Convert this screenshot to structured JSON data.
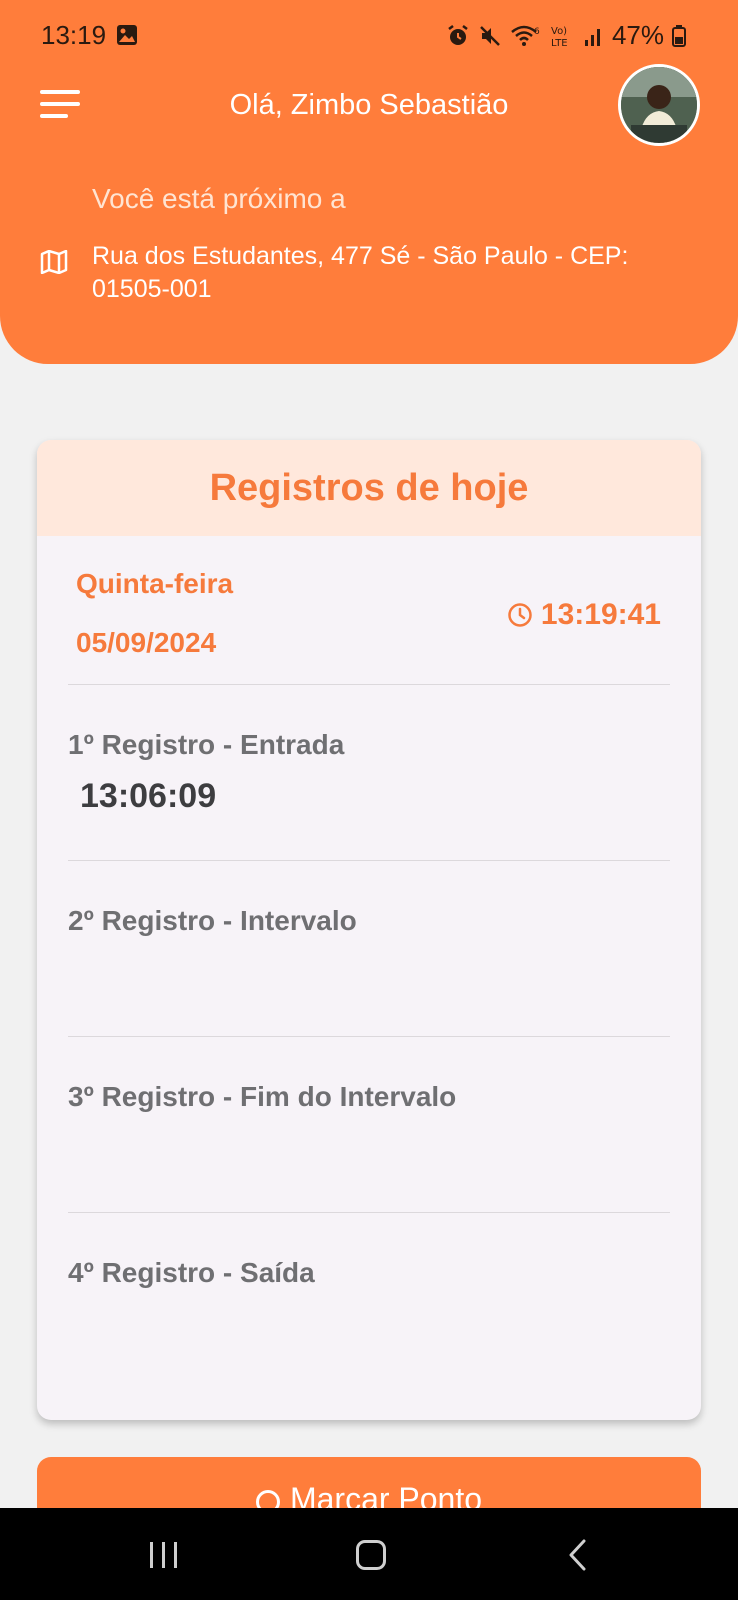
{
  "status_bar": {
    "time": "13:19",
    "battery": "47%"
  },
  "header": {
    "greeting": "Olá, Zimbo Sebastião",
    "near_label": "Você está próximo a",
    "address": "Rua dos Estudantes, 477 Sé - São Paulo - CEP: 01505-001"
  },
  "card": {
    "title": "Registros de hoje",
    "weekday": "Quinta-feira",
    "date": "05/09/2024",
    "clock": "13:19:41",
    "records": [
      {
        "label": "1º Registro - Entrada",
        "time": "13:06:09"
      },
      {
        "label": "2º Registro - Intervalo",
        "time": ""
      },
      {
        "label": "3º Registro - Fim do Intervalo",
        "time": ""
      },
      {
        "label": "4º Registro - Saída",
        "time": ""
      }
    ]
  },
  "actions": {
    "mark_label": "Marcar Ponto"
  },
  "colors": {
    "accent": "#ff7d3b",
    "card_header_bg": "#ffe8dc",
    "accent_text": "#f67a3c"
  },
  "icons": [
    "gallery-icon",
    "alarm-icon",
    "mute-icon",
    "wifi-icon",
    "volte-icon",
    "signal-icon",
    "battery-icon",
    "menu-icon",
    "avatar",
    "map-icon",
    "clock-icon",
    "recents-icon",
    "home-icon",
    "back-icon"
  ]
}
